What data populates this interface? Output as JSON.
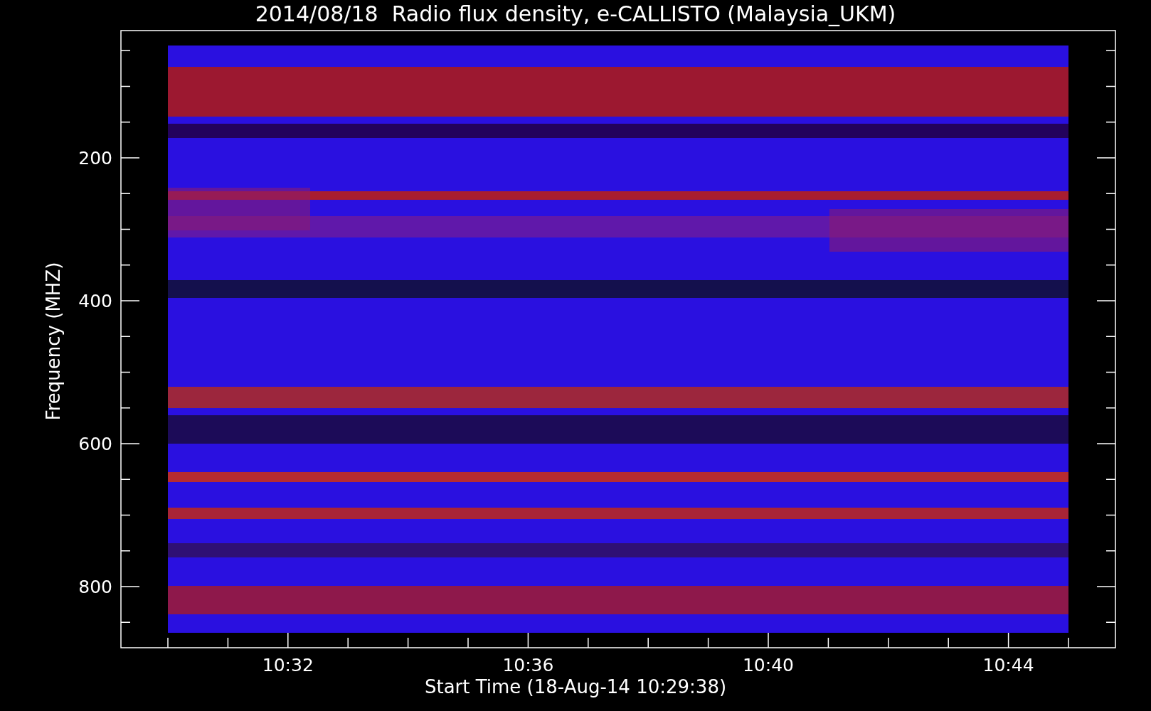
{
  "title": "2014/08/18  Radio flux density, e-CALLISTO (Malaysia_UKM)",
  "y_axis": {
    "label": "Frequency (MHZ)",
    "ticks": [
      "200",
      "400",
      "600",
      "800"
    ]
  },
  "x_axis": {
    "label": "Start Time (18-Aug-14 10:29:38)",
    "ticks": [
      "10:32",
      "10:36",
      "10:40",
      "10:44"
    ]
  }
}
